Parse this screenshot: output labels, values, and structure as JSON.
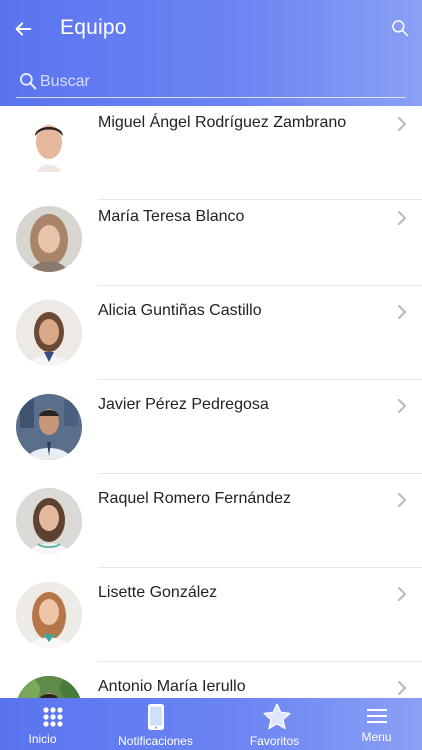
{
  "header": {
    "title": "Equipo",
    "back_icon": "back-arrow-icon",
    "search_icon": "search-icon"
  },
  "search": {
    "placeholder": "Buscar",
    "value": ""
  },
  "team": [
    {
      "name": "Miguel Ángel Rodríguez Zambrano"
    },
    {
      "name": "María Teresa Blanco"
    },
    {
      "name": "Alicia Guntiñas Castillo"
    },
    {
      "name": "Javier Pérez Pedregosa"
    },
    {
      "name": "Raquel Romero Fernández"
    },
    {
      "name": "Lisette González"
    },
    {
      "name": "Antonio María Ierullo"
    }
  ],
  "tabbar": {
    "items": [
      {
        "label": "Inicio",
        "icon": "grid-icon"
      },
      {
        "label": "Notificaciones",
        "icon": "phone-icon"
      },
      {
        "label": "Favoritos",
        "icon": "star-icon"
      },
      {
        "label": "Menu",
        "icon": "hamburger-icon"
      }
    ]
  },
  "colors": {
    "accent": "#5a74f0",
    "accent_light": "#8aa0f5",
    "text": "#222222",
    "chevron": "#b8b8b8"
  }
}
